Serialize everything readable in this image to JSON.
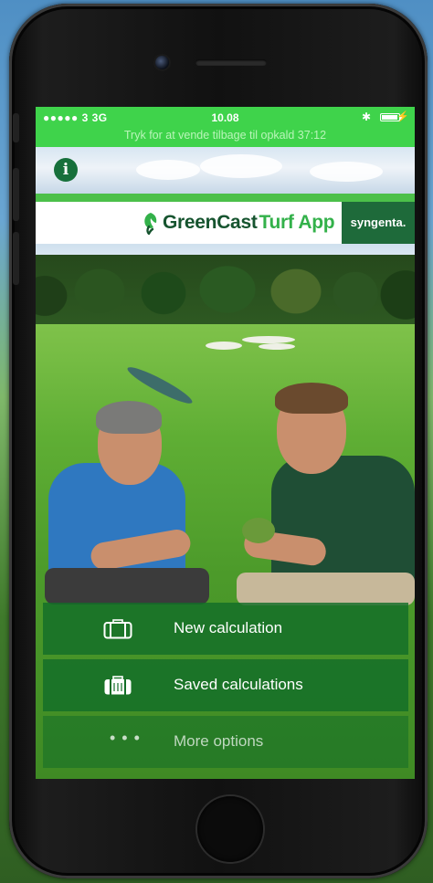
{
  "status_bar": {
    "carrier": "●●●●● 3  3G",
    "time": "10.08",
    "bluetooth_icon": "bluetooth-icon",
    "battery_icon": "battery-icon",
    "call_banner": "Tryk for at vende tilbage til opkald  37:12"
  },
  "header": {
    "info_icon": "info-icon",
    "brand_name": "GreenCast",
    "brand_product": "Turf App",
    "partner_logo": "syngenta."
  },
  "menu": {
    "items": [
      {
        "label": "New calculation",
        "icon": "briefcase-outline-icon"
      },
      {
        "label": "Saved calculations",
        "icon": "briefcase-filled-icon"
      },
      {
        "label": "More options",
        "icon": "more-dots-icon"
      }
    ]
  },
  "colors": {
    "status_bar_bg": "#3fd34b",
    "brand_dark_green": "#16542f",
    "brand_light_green": "#33b14a",
    "syngenta_green": "#1e6a3a",
    "menu_bg": "#126e28"
  }
}
